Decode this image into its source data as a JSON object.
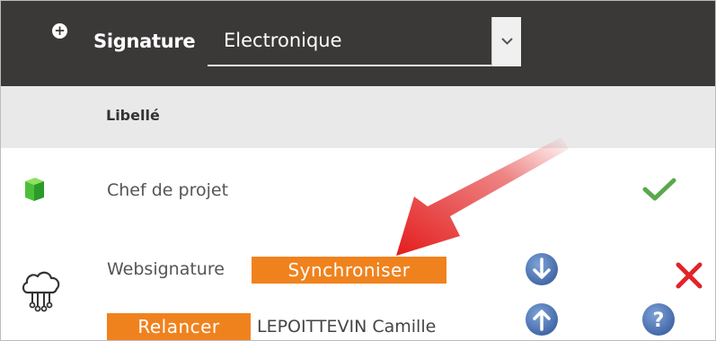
{
  "toolbar": {
    "add_icon": "plus-circle-icon",
    "signature_label": "Signature",
    "signature_select": {
      "value": "Electronique"
    }
  },
  "table": {
    "column_header": "Libellé",
    "rows": [
      {
        "icon": "green-cube-icon",
        "label": "Chef de projet",
        "status_icon": "check-icon"
      },
      {
        "icon": "cloud-network-icon",
        "label": "Websignature",
        "sync_button": "Synchroniser",
        "relance_button": "Relancer",
        "signer_name": "LEPOITTEVIN Camille",
        "icons": [
          "arrow-down-circle-icon",
          "arrow-up-circle-icon",
          "help-circle-icon",
          "close-x-icon"
        ]
      }
    ]
  },
  "colors": {
    "toolbar_bg": "#3b3838",
    "header_bg": "#e9e9e9",
    "accent_orange": "#f0821e",
    "check_green": "#5aa84c",
    "x_red": "#e0242a",
    "circle_blue": "#4f79b8",
    "annotation_arrow": "#e02020"
  }
}
